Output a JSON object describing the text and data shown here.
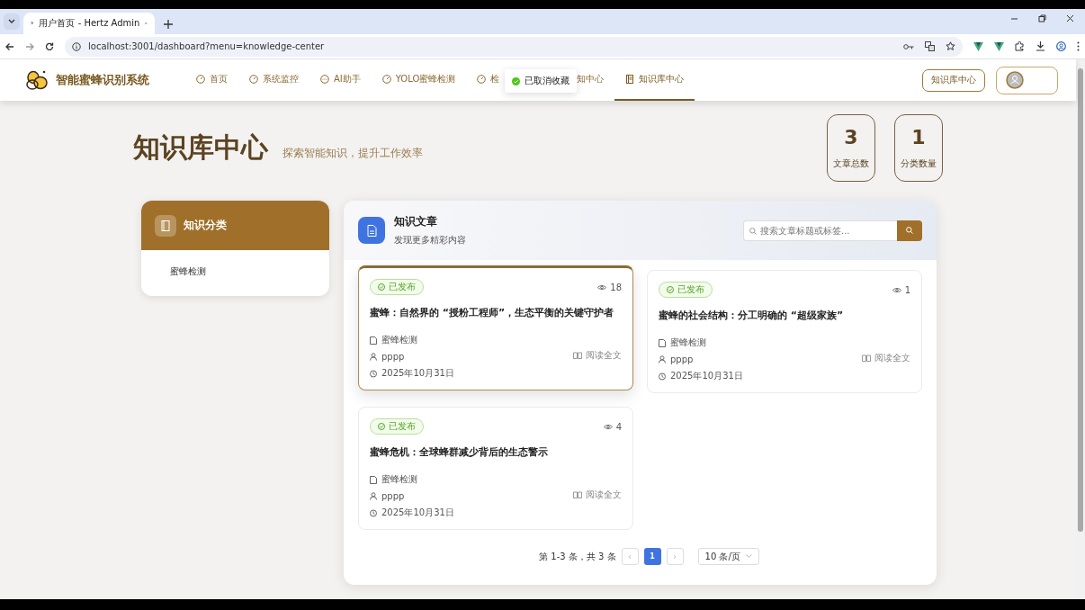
{
  "browser": {
    "tab_title": "用户首页 - Hertz Admin",
    "url": "localhost:3001/dashboard?menu=knowledge-center"
  },
  "header": {
    "brand": "智能蜜蜂识别系统",
    "nav": [
      {
        "label": "首页",
        "kind": "page",
        "selected": false
      },
      {
        "label": "系统监控",
        "kind": "page",
        "selected": false
      },
      {
        "label": "AI助手",
        "kind": "assistant",
        "selected": false
      },
      {
        "label": "YOLO蜜蜂检测",
        "kind": "page",
        "selected": false
      },
      {
        "label": "检",
        "kind": "page",
        "selected": false
      },
      {
        "label": "知中心",
        "kind": "covered",
        "selected": false
      },
      {
        "label": "知识库中心",
        "kind": "library",
        "selected": true
      }
    ],
    "action_button": "知识库中心"
  },
  "toast": {
    "text": "已取消收藏",
    "kind": "success"
  },
  "hero": {
    "title": "知识库中心",
    "subtitle": "探索智能知识，提升工作效率",
    "stats": [
      {
        "value": "3",
        "label": "文章总数"
      },
      {
        "value": "1",
        "label": "分类数量"
      }
    ]
  },
  "sidebar": {
    "title": "知识分类",
    "items": [
      {
        "label": "蜜蜂检测",
        "selected": false
      }
    ]
  },
  "articles": {
    "title": "知识文章",
    "subtitle": "发现更多精彩内容",
    "search": {
      "placeholder": "搜索文章标题或标签..."
    },
    "cards": [
      {
        "status": "已发布",
        "views": "18",
        "title": "蜜蜂：自然界的 “授粉工程师”，生态平衡的关键守护者",
        "category": "蜜蜂检测",
        "author": "pppp",
        "date": "2025年10月31日",
        "read": "阅读全文",
        "selected": true
      },
      {
        "status": "已发布",
        "views": "1",
        "title": "蜜蜂的社会结构：分工明确的 “超级家族”",
        "category": "蜜蜂检测",
        "author": "pppp",
        "date": "2025年10月31日",
        "read": "阅读全文",
        "selected": false
      },
      {
        "status": "已发布",
        "views": "4",
        "title": "蜜蜂危机：全球蜂群减少背后的生态警示",
        "category": "蜜蜂检测",
        "author": "pppp",
        "date": "2025年10月31日",
        "read": "阅读全文",
        "selected": false
      }
    ],
    "pagination": {
      "summary": "第 1-3 条，共 3 条",
      "prev": "‹",
      "next": "›",
      "pages": [
        {
          "label": "1",
          "selected": true
        }
      ],
      "page_size": "10 条/页"
    }
  }
}
